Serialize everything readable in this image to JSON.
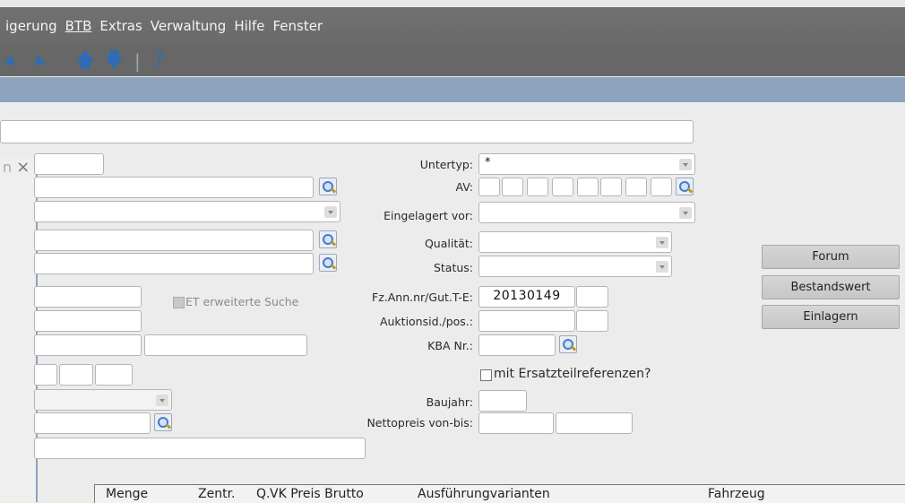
{
  "menu": [
    "igerung",
    "BTB",
    "Extras",
    "Verwaltung",
    "Hilfe",
    "Fenster"
  ],
  "toolbar": {
    "prev": "◂",
    "next": "▸",
    "up": "🡅",
    "down": "🡇",
    "sep": "|",
    "help": "?"
  },
  "subwindow": {
    "close": "×",
    "left_char": "n"
  },
  "filters": {
    "untertyp_label": "Untertyp:",
    "untertyp_value": "*",
    "av_label": "AV:",
    "eingelagert_label": "Eingelagert vor:",
    "qualitaet_label": "Qualität:",
    "status_label": "Status:",
    "fz_label": "Fz.Ann.nr/Gut.T-E:",
    "fz_value": "20130149",
    "auktion_label": "Auktionsid./pos.:",
    "kba_label": "KBA Nr.:",
    "ersatz_label": "mit Ersatzteilreferenzen?",
    "baujahr_label": "Baujahr:",
    "netto_label": "Nettopreis von-bis:",
    "et_label": "ET erweiterte Suche"
  },
  "buttons": {
    "forum": "Forum",
    "bestand": "Bestandswert",
    "einlagern": "Einlagern"
  },
  "table": {
    "columns": [
      "Menge",
      "Zentr.",
      "Q.",
      "VK Preis Brutto",
      "Ausführungvarianten",
      "Fahrzeug"
    ]
  }
}
